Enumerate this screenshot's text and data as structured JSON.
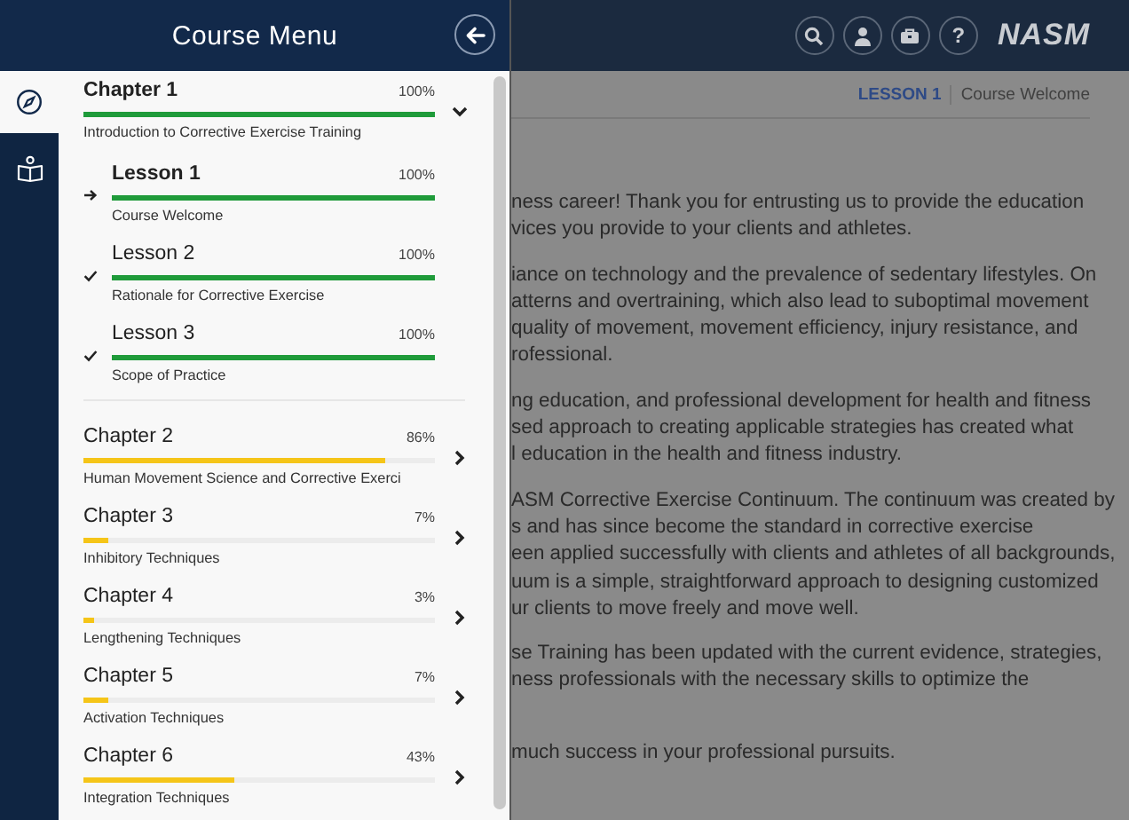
{
  "drawer": {
    "title": "Course Menu",
    "rail": [
      {
        "kind": "compass",
        "selected": true
      },
      {
        "kind": "book",
        "selected": false
      }
    ],
    "chapters": [
      {
        "title": "Chapter 1",
        "percent": "100%",
        "level": 1,
        "subtitle": "Introduction to Corrective Exercise Training",
        "expanded": true,
        "lessons": [
          {
            "current": true,
            "title": "Lesson 1",
            "percent": "100%",
            "level": 1,
            "subtitle": "Course Welcome"
          },
          {
            "current": false,
            "done": true,
            "title": "Lesson 2",
            "percent": "100%",
            "level": 1,
            "subtitle": "Rationale for Corrective Exercise"
          },
          {
            "current": false,
            "done": true,
            "title": "Lesson 3",
            "percent": "100%",
            "level": 1,
            "subtitle": "Scope of Practice"
          }
        ]
      },
      {
        "title": "Chapter 2",
        "percent": "86%",
        "level": 0.86,
        "subtitle": "Human Movement Science and Corrective Exerci",
        "expanded": false
      },
      {
        "title": "Chapter 3",
        "percent": "7%",
        "level": 0.07,
        "subtitle": "Inhibitory Techniques",
        "expanded": false
      },
      {
        "title": "Chapter 4",
        "percent": "3%",
        "level": 0.03,
        "subtitle": "Lengthening Techniques",
        "expanded": false
      },
      {
        "title": "Chapter 5",
        "percent": "7%",
        "level": 0.07,
        "subtitle": "Activation Techniques",
        "expanded": false
      },
      {
        "title": "Chapter 6",
        "percent": "43%",
        "level": 0.43,
        "subtitle": "Integration Techniques",
        "expanded": false
      }
    ]
  },
  "header": {
    "tools": [
      {
        "kind": "search"
      },
      {
        "kind": "user"
      },
      {
        "kind": "toolbox"
      },
      {
        "kind": "help",
        "glyph": "?"
      }
    ],
    "logo": "NASM"
  },
  "breadcrumb": {
    "lesson": "LESSON 1",
    "title": "Course Welcome"
  },
  "paragraphs": [
    {
      "lines": [
        "ness career! Thank you for entrusting us to provide the education",
        "vices you provide to your clients and athletes."
      ]
    },
    {
      "lines": [
        "iance on technology and the prevalence of sedentary lifestyles. On",
        "atterns and overtraining, which also lead to suboptimal movement",
        "quality of movement, movement efficiency, injury resistance, and",
        "rofessional."
      ]
    },
    {
      "lines": [
        "ng education, and professional development for health and fitness",
        "sed approach to creating applicable strategies has created what",
        "l education in the health and fitness industry."
      ]
    },
    {
      "lines": [
        "ASM Corrective Exercise Continuum. The continuum was created by",
        "s and has since become the standard in corrective exercise",
        "een applied successfully with clients and athletes of all backgrounds,",
        "uum is a simple, straightforward approach to designing customized",
        "ur clients to move freely and move well."
      ]
    },
    {
      "lines": [
        "se Training has been updated with the current evidence, strategies,",
        "ness professionals with the necessary skills to optimize the"
      ]
    },
    {
      "lines": [
        "much success in your professional pursuits."
      ]
    }
  ]
}
